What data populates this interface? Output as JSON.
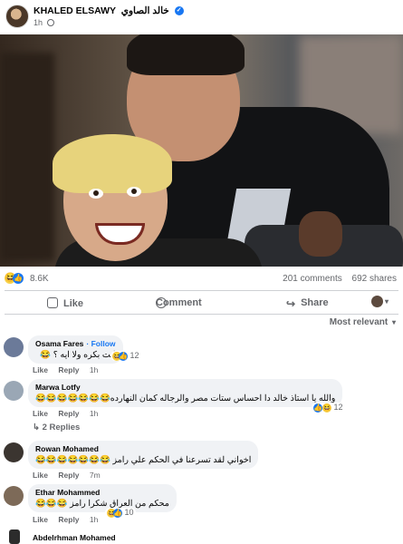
{
  "post": {
    "page_name": "KHALED ELSAWY",
    "page_name_ar": "خالد الصاوي",
    "time": "1h",
    "reaction_count": "8.6K",
    "comments_count": "201 comments",
    "shares_count": "692 shares"
  },
  "actions": {
    "like": "Like",
    "comment": "Comment",
    "share": "Share"
  },
  "sort_label": "Most relevant",
  "icons": {
    "laugh": "😆",
    "like": "👍",
    "share": "↪",
    "verified": "✓",
    "caret": "▾"
  },
  "comments": [
    {
      "author": "Osama Fares",
      "follow": "· Follow",
      "text": "انت بكره ولا ايه ؟ 😂",
      "like": "Like",
      "reply": "Reply",
      "time": "1h",
      "reactions": "12"
    },
    {
      "author": "Marwa Lotfy",
      "text": "والله يا استاذ خالد دا احساس ستات مصر والرجاله كمان النهارده😂😂😂😂😂😂😂",
      "like": "Like",
      "reply": "Reply",
      "time": "1h",
      "reactions": "12",
      "replies": "2 Replies"
    },
    {
      "author": "Rowan Mohamed",
      "text": "اخواني لقد تسرعنا في الحكم علي رامز 😂😂😂😂😂😂😂",
      "like": "Like",
      "reply": "Reply",
      "time": "7m"
    },
    {
      "author": "Ethar Mohammed",
      "text": "محكم من العراق شكرا رامز 😂😂😂",
      "like": "Like",
      "reply": "Reply",
      "time": "1h",
      "reactions": "10"
    }
  ],
  "cut_comment_author": "Abdelrhman Mohamed"
}
